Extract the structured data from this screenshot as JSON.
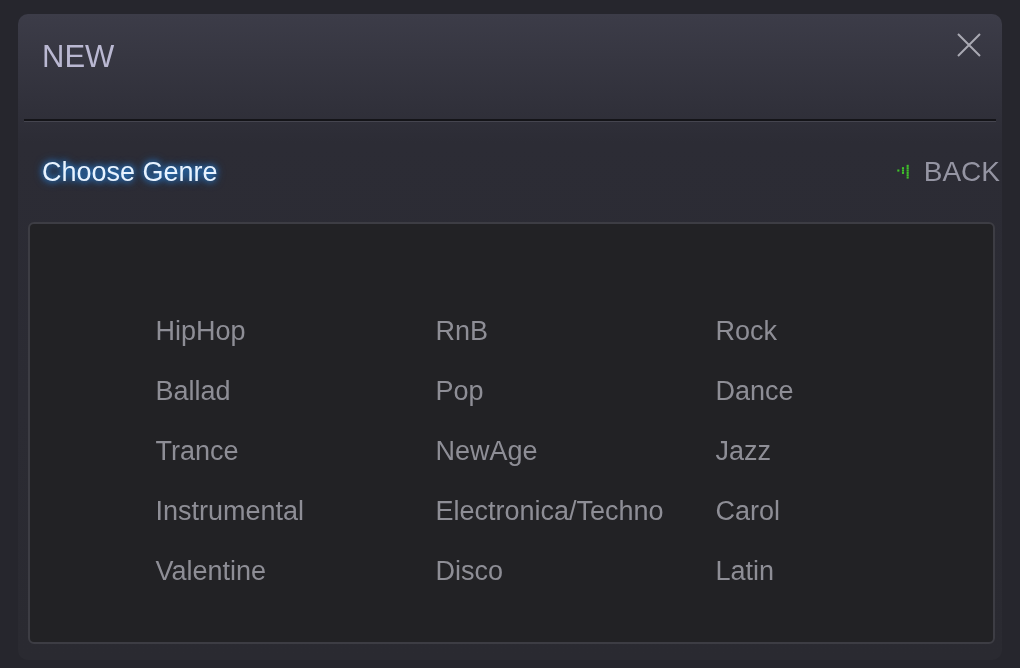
{
  "window": {
    "title": "NEW"
  },
  "header": {
    "heading": "Choose Genre",
    "back_label": "BACK"
  },
  "genres": [
    [
      "HipHop",
      "RnB",
      "Rock"
    ],
    [
      "Ballad",
      "Pop",
      "Dance"
    ],
    [
      "Trance",
      "NewAge",
      "Jazz"
    ],
    [
      "Instrumental",
      "Electronica/Techno",
      "Carol"
    ],
    [
      "Valentine",
      "Disco",
      "Latin"
    ]
  ]
}
